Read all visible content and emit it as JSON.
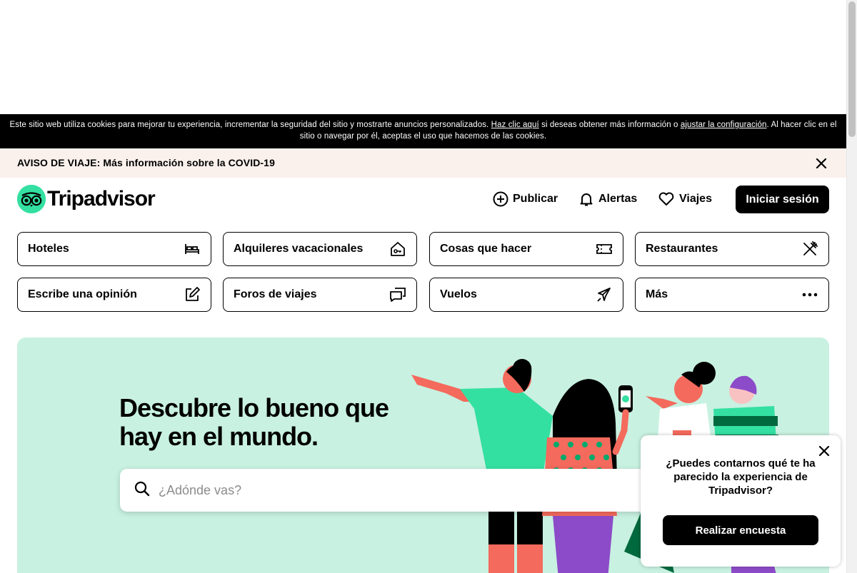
{
  "cookie_banner": {
    "text_before": "Este sitio web utiliza cookies para mejorar tu experiencia, incrementar la seguridad del sitio y mostrarte anuncios personalizados. ",
    "link1": "Haz clic aquí",
    "text_middle": " si deseas obtener más información o ",
    "link2": "ajustar la configuración",
    "text_after": ". Al hacer clic en el sitio o navegar por él, aceptas el uso que hacemos de las cookies."
  },
  "notice": {
    "text": "AVISO DE VIAJE: Más información sobre la COVID-19",
    "close_icon": "close-icon"
  },
  "header": {
    "logo_text": "Tripadvisor",
    "post_label": "Publicar",
    "alerts_label": "Alertas",
    "trips_label": "Viajes",
    "signin_label": "Iniciar sesión"
  },
  "categories": [
    {
      "label": "Hoteles",
      "icon": "bed-icon"
    },
    {
      "label": "Alquileres vacacionales",
      "icon": "house-key-icon"
    },
    {
      "label": "Cosas que hacer",
      "icon": "ticket-icon"
    },
    {
      "label": "Restaurantes",
      "icon": "utensils-icon"
    },
    {
      "label": "Escribe una opinión",
      "icon": "edit-icon"
    },
    {
      "label": "Foros de viajes",
      "icon": "chat-icon"
    },
    {
      "label": "Vuelos",
      "icon": "plane-icon"
    },
    {
      "label": "Más",
      "icon": "more-icon"
    }
  ],
  "hero": {
    "title_line1": "Descubre lo bueno que",
    "title_line2": "hay en el mundo.",
    "search_placeholder": "¿Adónde vas?"
  },
  "survey": {
    "question": "¿Puedes contarnos qué te ha parecido la experiencia de Tripadvisor?",
    "button_label": "Realizar encuesta"
  },
  "colors": {
    "brand_green": "#34e0a1",
    "hero_bg": "#c8f1e1",
    "notice_bg": "#faf1ed"
  }
}
